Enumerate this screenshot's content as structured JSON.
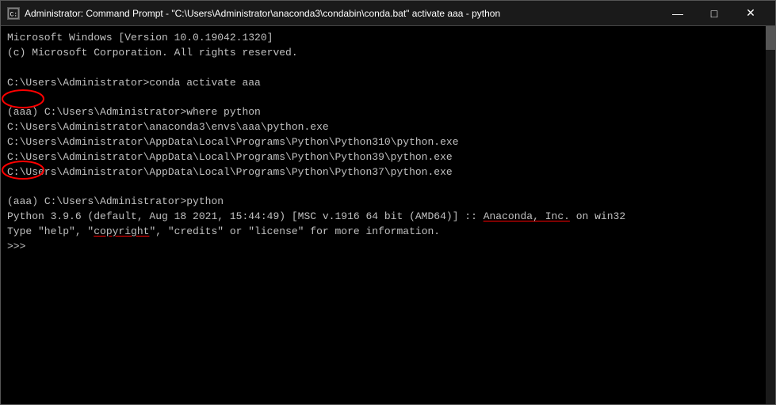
{
  "window": {
    "title": "Administrator: Command Prompt - \"C:\\Users\\Administrator\\anaconda3\\condabin\\conda.bat\"  activate aaa - python"
  },
  "titlebar": {
    "minimize_label": "—",
    "maximize_label": "□",
    "close_label": "✕"
  },
  "terminal": {
    "lines": [
      "Microsoft Windows [Version 10.0.19042.1320]",
      "(c) Microsoft Corporation. All rights reserved.",
      "",
      "C:\\Users\\Administrator>conda activate aaa",
      "",
      "(aaa) C:\\Users\\Administrator>where python",
      "C:\\Users\\Administrator\\anaconda3\\envs\\aaa\\python.exe",
      "C:\\Users\\Administrator\\AppData\\Local\\Programs\\Python\\Python310\\python.exe",
      "C:\\Users\\Administrator\\AppData\\Local\\Programs\\Python\\Python39\\python.exe",
      "C:\\Users\\Administrator\\AppData\\Local\\Programs\\Python\\Python37\\python.exe",
      "",
      "(aaa) C:\\Users\\Administrator>python",
      "Python 3.9.6 (default, Aug 18 2021, 15:44:49) [MSC v.1916 64 bit (AMD64)] :: Anaconda, Inc. on win32",
      "Type \"help\", \"copyright\", \"credits\" or \"license\" for more information.",
      ">>> "
    ]
  }
}
